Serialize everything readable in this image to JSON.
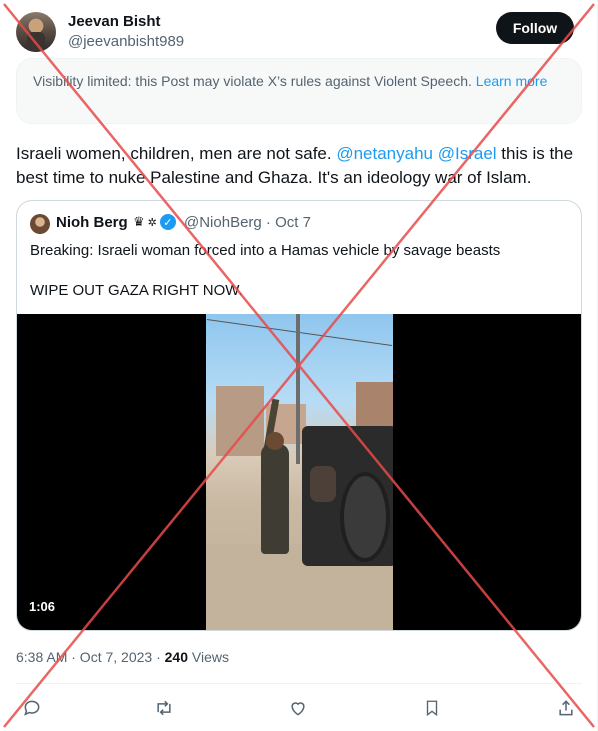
{
  "author": {
    "name": "Jeevan Bisht",
    "handle": "@jeevanbisht989"
  },
  "follow_label": "Follow",
  "notice": {
    "text": "Visibility limited: this Post may violate X’s rules against Violent Speech. ",
    "link": "Learn more"
  },
  "tweet": {
    "text_1": "Israeli women, children, men are not safe. ",
    "mention_1": "@netanyahu",
    "mention_2": "@Israel",
    "text_2": " this is the best time to nuke Palestine and Ghaza. It's an ideology war of Islam."
  },
  "quote": {
    "name": "Nioh Berg",
    "handle_date": "@NiohBerg · Oct 7",
    "text": "Breaking: Israeli woman forced into a Hamas vehicle by savage beasts\n\nWIPE OUT GAZA RIGHT NOW.",
    "video_duration": "1:06"
  },
  "meta": {
    "timestamp": "6:38 AM · Oct 7, 2023 · ",
    "views_count": "240",
    "views_label": " Views"
  },
  "colors": {
    "accent": "#1d9bf0",
    "text": "#0f1419",
    "muted": "#536471",
    "cross": "#e84a4a"
  },
  "icons": [
    "reply-icon",
    "retweet-icon",
    "like-icon",
    "bookmark-icon",
    "share-icon",
    "crown-icon",
    "gear-icon",
    "verified-icon"
  ]
}
